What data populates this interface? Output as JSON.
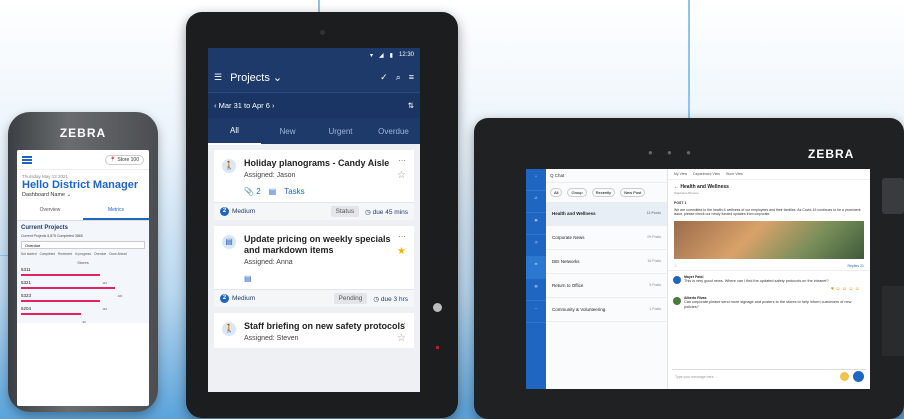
{
  "phone": {
    "brand": "ZEBRA",
    "store": "Store 100",
    "date": "Thursday May 13 2021",
    "greeting": "Hello District Manager",
    "dashboard": "Dashboard Name",
    "tabs": [
      "Overview",
      "Metrics"
    ],
    "current_projects": "Current Projects",
    "meta": "Current Projects 5,875   Completed 3865",
    "filter": "Overdue",
    "legend": [
      "Not started",
      "Completed",
      "Reviewed",
      "In progress",
      "Overdue",
      "Done Ahead"
    ],
    "stores_label": "Stores",
    "rows": [
      {
        "label": "5311",
        "value": "110",
        "fill": 0.8
      },
      {
        "label": "5321",
        "value": "130",
        "fill": 0.95
      },
      {
        "label": "5323",
        "value": "110",
        "fill": 0.8
      },
      {
        "label": "5204",
        "value": "90",
        "fill": 0.6
      }
    ]
  },
  "tablet": {
    "time": "12:30",
    "title": "Projects",
    "date_range": "Mar 31 to Apr 6",
    "tabs": [
      "All",
      "New",
      "Urgent",
      "Overdue"
    ],
    "cards": [
      {
        "title": "Holiday planograms - Candy Aisle",
        "assigned": "Assigned: Jason",
        "attach_count": "2",
        "tasks_label": "Tasks",
        "priority": "Medium",
        "priority_num": "2",
        "status": "Status",
        "due": "due 45 mins",
        "starred": false
      },
      {
        "title": "Update pricing on weekly specials and markdown items",
        "assigned": "Assigned: Anna",
        "priority": "Medium",
        "priority_num": "2",
        "status": "Pending",
        "due": "due 3 hrs",
        "starred": true
      },
      {
        "title": "Staff briefing on new safety protocols",
        "assigned": "Assigned: Steven",
        "starred": false
      }
    ]
  },
  "rugged": {
    "brand": "ZEBRA",
    "chat_title": "Q Chat",
    "filters": [
      "All",
      "Group",
      "Recently",
      "New Post"
    ],
    "channels": [
      {
        "name": "Health and Wellness",
        "count": "13 Posts"
      },
      {
        "name": "Corporate News",
        "count": "09 Posts"
      },
      {
        "name": "DEI Networks",
        "count": "16 Posts"
      },
      {
        "name": "Return to Office",
        "count": "9 Posts"
      },
      {
        "name": "Community & Volunteering",
        "count": "1 Posts"
      }
    ],
    "topbar": [
      "My View",
      "Department View",
      "Store View"
    ],
    "post_title": "Health and Wellness",
    "post_sub": "Stephanie Broome",
    "post_heading": "POST 1",
    "post_body": "We are committed to the health & wellness of our employees and their families. As Covid-19 continues to be a prominent issue, please check our newly funded updates from corporate.",
    "replies": "Replies 21",
    "messages": [
      {
        "name": "Mayer Patel",
        "text": "This is very good news. Where can I find the updated safety protocols on the intranet?"
      },
      {
        "name": "Alberto Rivas",
        "text": "Can corporate please send more signage and posters to the stores to help inform customers of new policies?"
      }
    ],
    "input_placeholder": "Type your message here..."
  }
}
